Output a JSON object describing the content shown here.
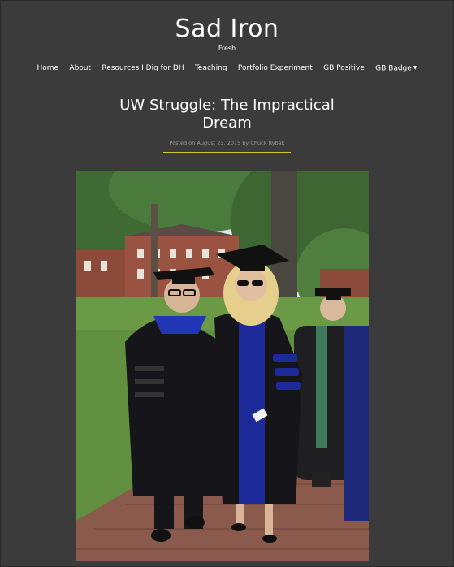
{
  "site": {
    "title": "Sad Iron",
    "tagline": "Fresh"
  },
  "nav": {
    "items": [
      {
        "label": "Home"
      },
      {
        "label": "About"
      },
      {
        "label": "Resources I Dig for DH"
      },
      {
        "label": "Teaching"
      },
      {
        "label": "Portfolio Experiment"
      },
      {
        "label": "GB Positive"
      },
      {
        "label": "GB Badge",
        "has_dropdown": true
      }
    ]
  },
  "post": {
    "title": "UW Struggle: The Impractical Dream",
    "meta": {
      "prefix": "Posted on",
      "date": "August 23, 2015",
      "by": "by",
      "author": "Chuck Rybak"
    }
  },
  "colors": {
    "background": "#3b3b3b",
    "accent": "#d7c52a",
    "meta_text": "#9a9a9a"
  }
}
